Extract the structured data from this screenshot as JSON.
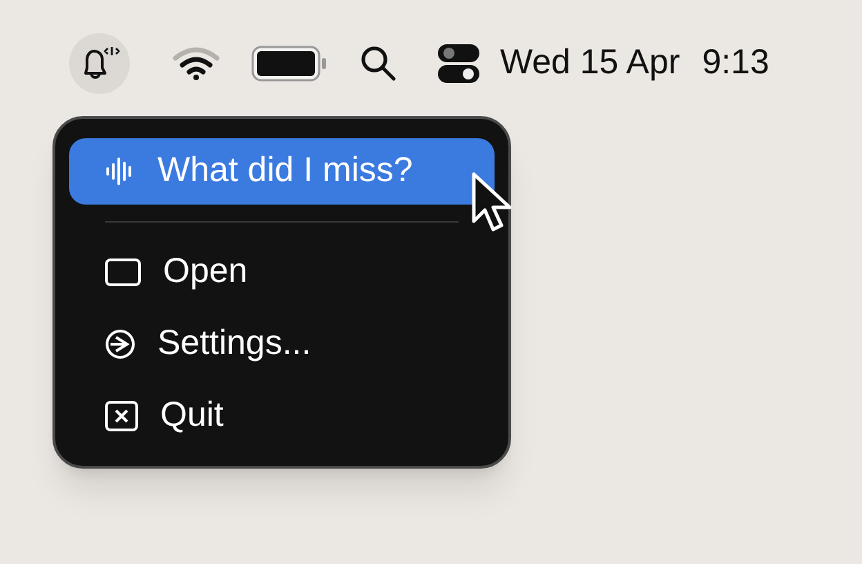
{
  "menu_bar": {
    "notification_icon_selected": true,
    "date": "Wed 15 Apr",
    "time": "9:13"
  },
  "menu": {
    "items": [
      {
        "kind": "waveform",
        "label": "What did I miss?",
        "selected": true
      },
      {
        "kind": "separator"
      },
      {
        "kind": "window",
        "label": "Open",
        "selected": false
      },
      {
        "kind": "settings",
        "label": "Settings...",
        "selected": false
      },
      {
        "kind": "quit",
        "label": "Quit",
        "selected": false
      }
    ]
  }
}
